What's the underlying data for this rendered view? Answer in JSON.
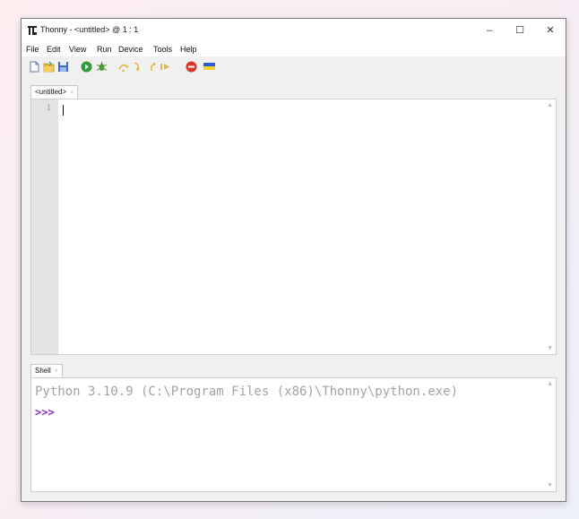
{
  "window": {
    "title": "Thonny  -  <untitled>  @  1 : 1",
    "minimize": "–",
    "maximize": "☐",
    "close": "✕"
  },
  "menu": [
    {
      "label": "File"
    },
    {
      "label": "Edit"
    },
    {
      "label": "View"
    },
    {
      "label": "Run"
    },
    {
      "label": "Device"
    },
    {
      "label": "Tools"
    },
    {
      "label": "Help"
    }
  ],
  "toolbar": {
    "icons": [
      "new-file-icon",
      "open-file-icon",
      "save-icon",
      "run-icon",
      "debug-icon",
      "step-over-icon",
      "step-into-icon",
      "step-out-icon",
      "resume-icon",
      "stop-icon",
      "flag-icon"
    ]
  },
  "editor": {
    "tab_label": "<untitled>",
    "tab_close": "×",
    "line_number": "1"
  },
  "shell": {
    "tab_label": "Shell",
    "tab_close": "×",
    "banner": "Python 3.10.9 (C:\\Program Files (x86)\\Thonny\\python.exe)",
    "prompt": ">>>"
  },
  "colors": {
    "prompt": "#8a2bb3",
    "banner": "#a3a3a3",
    "gutter": "#e4e4e4"
  }
}
